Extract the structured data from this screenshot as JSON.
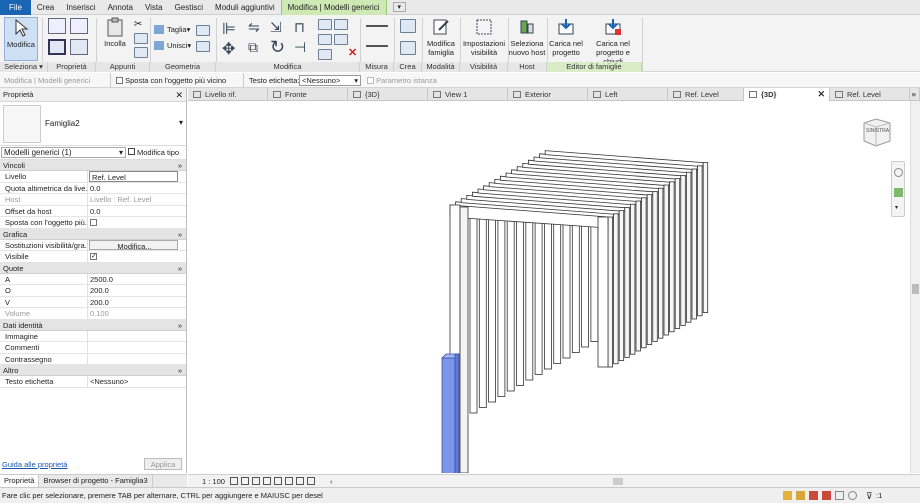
{
  "menubar": {
    "items": [
      "File",
      "Crea",
      "Inserisci",
      "Annota",
      "Vista",
      "Gestisci",
      "Moduli aggiuntivi",
      "Modifica | Modelli generici",
      "▾"
    ]
  },
  "ribbon": {
    "buttons": {
      "modifica": "Modifica",
      "incolla": "Incolla",
      "taglia": "Taglia",
      "unisci": "Unisci",
      "modifica_famiglia": "Modifica famiglia",
      "impostazioni_visibilita": "Impostazioni visibilità",
      "seleziona_host": "Seleziona nuovo host",
      "carica_progetto": "Carica nel progetto",
      "carica_chiudi": "Carica nel progetto e chiudi"
    },
    "panels": [
      "Seleziona ▾",
      "Proprietà",
      "Appunti",
      "Geometria",
      "Modifica",
      "Misura",
      "Crea",
      "Modalità",
      "Visibilità",
      "Host",
      "Editor di famiglie"
    ]
  },
  "optionsbar": {
    "context": "Modifica | Modelli generici",
    "sposta_label": "Sposta con l'oggetto più vicino",
    "testo_label": "Testo etichetta:",
    "testo_value": "<Nessuno>",
    "param_label": "Parametro istanza"
  },
  "properties": {
    "title": "Proprietà",
    "family": "Famiglia2",
    "selector": "Modelli generici (1)",
    "edit_type": "Modifica tipo",
    "sections": {
      "vincoli": "Vincoli",
      "grafica": "Grafica",
      "quote": "Quote",
      "dati": "Dati identità",
      "altro": "Altro"
    },
    "rows": {
      "livello": [
        "Livello",
        "Ref. Level"
      ],
      "quota": [
        "Quota altimetrica da live...",
        "0.0"
      ],
      "host": [
        "Host",
        "Livello : Ref. Level"
      ],
      "offset": [
        "Offset da host",
        "0.0"
      ],
      "sposta": [
        "Sposta con l'oggetto più...",
        ""
      ],
      "sostituzioni": [
        "Sostituzioni visibilità/gra...",
        "Modifica..."
      ],
      "visibile": [
        "Visibile",
        "✓"
      ],
      "a": [
        "A",
        "2500.0"
      ],
      "o": [
        "O",
        "200.0"
      ],
      "v": [
        "V",
        "200.0"
      ],
      "volume": [
        "Volume",
        "0.100"
      ],
      "immagine": [
        "Immagine",
        ""
      ],
      "commenti": [
        "Commenti",
        ""
      ],
      "contrassegno": [
        "Contrassegno",
        ""
      ],
      "testo": [
        "Testo etichetta",
        "<Nessuno>"
      ]
    },
    "help_link": "Guida alle proprietà",
    "apply": "Applica"
  },
  "props_tabs": [
    "Proprietà",
    "Browser di progetto - Famiglia3"
  ],
  "tabs": [
    "Livello rif.",
    "Fronte",
    "{3D}",
    "View 1",
    "Exterior",
    "Left",
    "Ref. Level",
    "{3D}",
    "Ref. Level"
  ],
  "active_tab_index": 7,
  "viewcube_label": "SINISTRA",
  "viewbar": {
    "scale": "1 : 100"
  },
  "status": {
    "text": "Fare clic per selezionare, premere TAB per alternare, CTRL per aggiungere e MAIUSC per desel",
    "filter": ":1"
  }
}
